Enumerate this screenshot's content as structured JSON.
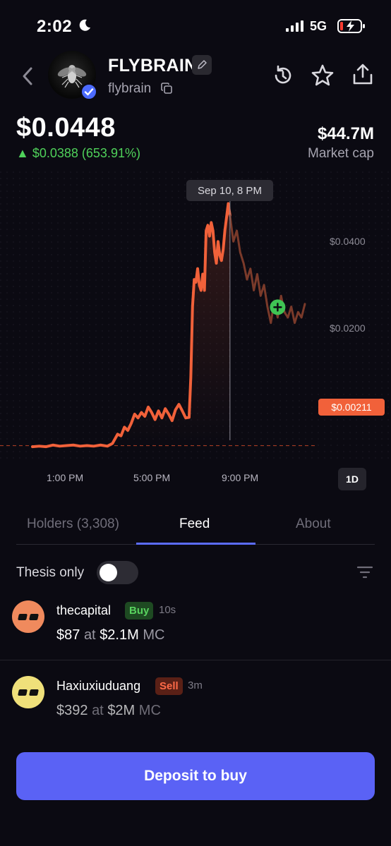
{
  "status_bar": {
    "time": "2:02",
    "network": "5G"
  },
  "token": {
    "name": "FLYBRAIN",
    "handle": "flybrain"
  },
  "price": {
    "value": "$0.0448",
    "change": "$0.0388 (653.91%)",
    "market_cap_value": "$44.7M",
    "market_cap_label": "Market cap"
  },
  "chart_data": {
    "type": "line",
    "x_labels": [
      "1:00 PM",
      "5:00 PM",
      "9:00 PM"
    ],
    "y_ticks": [
      "$0.0400",
      "$0.0200"
    ],
    "tooltip_time": "Sep 10, 8 PM",
    "current_price_tag": "$0.00211",
    "range": "1D",
    "ylim": [
      0,
      0.052
    ],
    "series": [
      {
        "color": "#f1613a",
        "points": [
          [
            0.0,
            0.0022
          ],
          [
            0.04,
            0.0023
          ],
          [
            0.08,
            0.0022
          ],
          [
            0.12,
            0.0025
          ],
          [
            0.16,
            0.0023
          ],
          [
            0.2,
            0.0024
          ],
          [
            0.24,
            0.0025
          ],
          [
            0.28,
            0.0023
          ],
          [
            0.32,
            0.0024
          ],
          [
            0.36,
            0.0023
          ],
          [
            0.4,
            0.0025
          ],
          [
            0.44,
            0.0023
          ],
          [
            0.47,
            0.0028
          ],
          [
            0.5,
            0.0045
          ],
          [
            0.52,
            0.0042
          ],
          [
            0.54,
            0.0058
          ],
          [
            0.56,
            0.0052
          ],
          [
            0.58,
            0.0065
          ],
          [
            0.6,
            0.0082
          ],
          [
            0.62,
            0.0075
          ],
          [
            0.64,
            0.0085
          ],
          [
            0.66,
            0.0078
          ],
          [
            0.68,
            0.0095
          ],
          [
            0.7,
            0.0085
          ],
          [
            0.72,
            0.0072
          ],
          [
            0.74,
            0.0088
          ],
          [
            0.76,
            0.0075
          ],
          [
            0.78,
            0.0092
          ],
          [
            0.8,
            0.0082
          ],
          [
            0.82,
            0.007
          ],
          [
            0.84,
            0.009
          ],
          [
            0.86,
            0.01
          ],
          [
            0.88,
            0.0088
          ],
          [
            0.9,
            0.0075
          ],
          [
            0.92,
            0.0076
          ],
          [
            0.93,
            0.015
          ],
          [
            0.94,
            0.028
          ],
          [
            0.95,
            0.033
          ],
          [
            0.96,
            0.0325
          ],
          [
            0.97,
            0.035
          ],
          [
            0.98,
            0.032
          ],
          [
            0.99,
            0.031
          ],
          [
            1.0,
            0.034
          ],
          [
            1.01,
            0.031
          ],
          [
            1.02,
            0.042
          ],
          [
            1.03,
            0.043
          ],
          [
            1.04,
            0.041
          ],
          [
            1.05,
            0.0435
          ],
          [
            1.06,
            0.042
          ],
          [
            1.07,
            0.038
          ],
          [
            1.08,
            0.036
          ],
          [
            1.09,
            0.04
          ],
          [
            1.1,
            0.0375
          ],
          [
            1.11,
            0.0365
          ],
          [
            1.12,
            0.0385
          ],
          [
            1.13,
            0.042
          ],
          [
            1.14,
            0.0445
          ],
          [
            1.15,
            0.047
          ],
          [
            1.16,
            0.0448
          ]
        ]
      },
      {
        "color": "#7a3a2a",
        "points": [
          [
            1.16,
            0.0448
          ],
          [
            1.18,
            0.04
          ],
          [
            1.2,
            0.042
          ],
          [
            1.22,
            0.038
          ],
          [
            1.24,
            0.036
          ],
          [
            1.26,
            0.033
          ],
          [
            1.28,
            0.035
          ],
          [
            1.3,
            0.031
          ],
          [
            1.32,
            0.034
          ],
          [
            1.34,
            0.03
          ],
          [
            1.36,
            0.032
          ],
          [
            1.38,
            0.028
          ],
          [
            1.4,
            0.025
          ],
          [
            1.42,
            0.029
          ],
          [
            1.44,
            0.026
          ],
          [
            1.46,
            0.03
          ],
          [
            1.48,
            0.027
          ],
          [
            1.5,
            0.026
          ],
          [
            1.52,
            0.028
          ],
          [
            1.54,
            0.025
          ],
          [
            1.56,
            0.027
          ],
          [
            1.58,
            0.026
          ],
          [
            1.6,
            0.0285
          ]
        ]
      }
    ]
  },
  "tabs": [
    {
      "label": "Holders (3,308)"
    },
    {
      "label": "Feed"
    },
    {
      "label": "About"
    }
  ],
  "filter": {
    "label": "Thesis only"
  },
  "feed": [
    {
      "user": "thecapital",
      "action": "Buy",
      "time": "10s",
      "amount": "$87",
      "at": "at",
      "mc": "$2.1M",
      "mc_suffix": "MC",
      "avatar_color": "#f08a5d"
    },
    {
      "user": "Haxiuxiuduang",
      "action": "Sell",
      "time": "3m",
      "amount": "$392",
      "at": "at",
      "mc": "$2M",
      "mc_suffix": "MC",
      "avatar_color": "#efe07a"
    }
  ],
  "deposit_label": "Deposit to buy"
}
